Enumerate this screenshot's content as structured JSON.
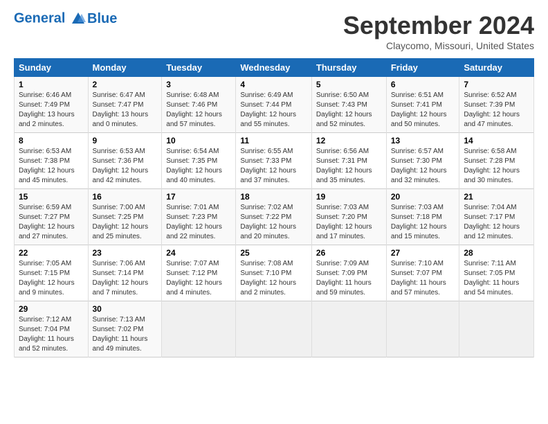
{
  "header": {
    "logo_line1": "General",
    "logo_line2": "Blue",
    "month_title": "September 2024",
    "location": "Claycomo, Missouri, United States"
  },
  "columns": [
    "Sunday",
    "Monday",
    "Tuesday",
    "Wednesday",
    "Thursday",
    "Friday",
    "Saturday"
  ],
  "weeks": [
    [
      {
        "day": "1",
        "info": "Sunrise: 6:46 AM\nSunset: 7:49 PM\nDaylight: 13 hours\nand 2 minutes."
      },
      {
        "day": "2",
        "info": "Sunrise: 6:47 AM\nSunset: 7:47 PM\nDaylight: 13 hours\nand 0 minutes."
      },
      {
        "day": "3",
        "info": "Sunrise: 6:48 AM\nSunset: 7:46 PM\nDaylight: 12 hours\nand 57 minutes."
      },
      {
        "day": "4",
        "info": "Sunrise: 6:49 AM\nSunset: 7:44 PM\nDaylight: 12 hours\nand 55 minutes."
      },
      {
        "day": "5",
        "info": "Sunrise: 6:50 AM\nSunset: 7:43 PM\nDaylight: 12 hours\nand 52 minutes."
      },
      {
        "day": "6",
        "info": "Sunrise: 6:51 AM\nSunset: 7:41 PM\nDaylight: 12 hours\nand 50 minutes."
      },
      {
        "day": "7",
        "info": "Sunrise: 6:52 AM\nSunset: 7:39 PM\nDaylight: 12 hours\nand 47 minutes."
      }
    ],
    [
      {
        "day": "8",
        "info": "Sunrise: 6:53 AM\nSunset: 7:38 PM\nDaylight: 12 hours\nand 45 minutes."
      },
      {
        "day": "9",
        "info": "Sunrise: 6:53 AM\nSunset: 7:36 PM\nDaylight: 12 hours\nand 42 minutes."
      },
      {
        "day": "10",
        "info": "Sunrise: 6:54 AM\nSunset: 7:35 PM\nDaylight: 12 hours\nand 40 minutes."
      },
      {
        "day": "11",
        "info": "Sunrise: 6:55 AM\nSunset: 7:33 PM\nDaylight: 12 hours\nand 37 minutes."
      },
      {
        "day": "12",
        "info": "Sunrise: 6:56 AM\nSunset: 7:31 PM\nDaylight: 12 hours\nand 35 minutes."
      },
      {
        "day": "13",
        "info": "Sunrise: 6:57 AM\nSunset: 7:30 PM\nDaylight: 12 hours\nand 32 minutes."
      },
      {
        "day": "14",
        "info": "Sunrise: 6:58 AM\nSunset: 7:28 PM\nDaylight: 12 hours\nand 30 minutes."
      }
    ],
    [
      {
        "day": "15",
        "info": "Sunrise: 6:59 AM\nSunset: 7:27 PM\nDaylight: 12 hours\nand 27 minutes."
      },
      {
        "day": "16",
        "info": "Sunrise: 7:00 AM\nSunset: 7:25 PM\nDaylight: 12 hours\nand 25 minutes."
      },
      {
        "day": "17",
        "info": "Sunrise: 7:01 AM\nSunset: 7:23 PM\nDaylight: 12 hours\nand 22 minutes."
      },
      {
        "day": "18",
        "info": "Sunrise: 7:02 AM\nSunset: 7:22 PM\nDaylight: 12 hours\nand 20 minutes."
      },
      {
        "day": "19",
        "info": "Sunrise: 7:03 AM\nSunset: 7:20 PM\nDaylight: 12 hours\nand 17 minutes."
      },
      {
        "day": "20",
        "info": "Sunrise: 7:03 AM\nSunset: 7:18 PM\nDaylight: 12 hours\nand 15 minutes."
      },
      {
        "day": "21",
        "info": "Sunrise: 7:04 AM\nSunset: 7:17 PM\nDaylight: 12 hours\nand 12 minutes."
      }
    ],
    [
      {
        "day": "22",
        "info": "Sunrise: 7:05 AM\nSunset: 7:15 PM\nDaylight: 12 hours\nand 9 minutes."
      },
      {
        "day": "23",
        "info": "Sunrise: 7:06 AM\nSunset: 7:14 PM\nDaylight: 12 hours\nand 7 minutes."
      },
      {
        "day": "24",
        "info": "Sunrise: 7:07 AM\nSunset: 7:12 PM\nDaylight: 12 hours\nand 4 minutes."
      },
      {
        "day": "25",
        "info": "Sunrise: 7:08 AM\nSunset: 7:10 PM\nDaylight: 12 hours\nand 2 minutes."
      },
      {
        "day": "26",
        "info": "Sunrise: 7:09 AM\nSunset: 7:09 PM\nDaylight: 11 hours\nand 59 minutes."
      },
      {
        "day": "27",
        "info": "Sunrise: 7:10 AM\nSunset: 7:07 PM\nDaylight: 11 hours\nand 57 minutes."
      },
      {
        "day": "28",
        "info": "Sunrise: 7:11 AM\nSunset: 7:05 PM\nDaylight: 11 hours\nand 54 minutes."
      }
    ],
    [
      {
        "day": "29",
        "info": "Sunrise: 7:12 AM\nSunset: 7:04 PM\nDaylight: 11 hours\nand 52 minutes."
      },
      {
        "day": "30",
        "info": "Sunrise: 7:13 AM\nSunset: 7:02 PM\nDaylight: 11 hours\nand 49 minutes."
      },
      {
        "day": "",
        "info": ""
      },
      {
        "day": "",
        "info": ""
      },
      {
        "day": "",
        "info": ""
      },
      {
        "day": "",
        "info": ""
      },
      {
        "day": "",
        "info": ""
      }
    ]
  ]
}
